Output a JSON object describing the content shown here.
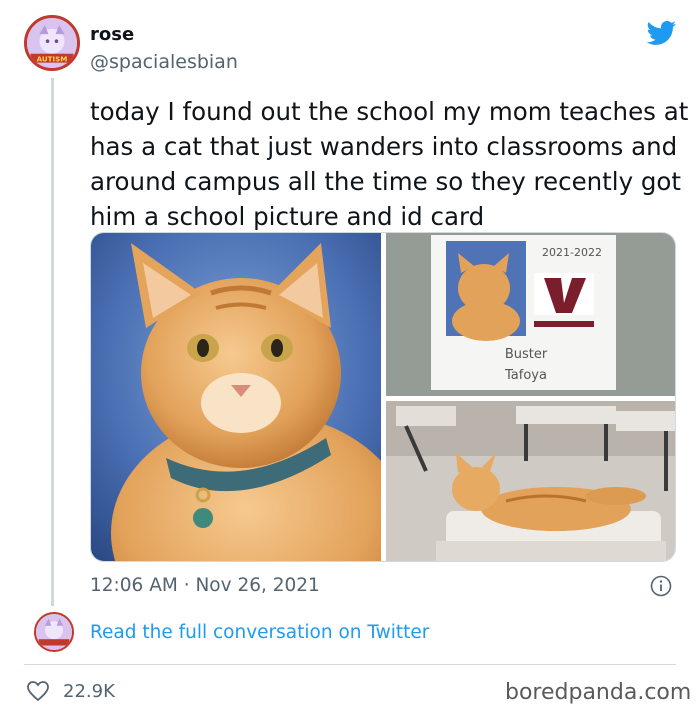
{
  "tweet": {
    "author_name": "rose",
    "author_handle": "@spacialesbian",
    "avatar_badge": "AUTISM",
    "text": "today I found out the school my mom teaches at has a cat that just wanders into classrooms and around campus all the time so they recently got him a school picture and id card",
    "timestamp": "12:06 AM · Nov 26, 2021",
    "read_more_label": "Read the full conversation on Twitter",
    "like_count": "22.9K"
  },
  "id_card": {
    "year": "2021-2022",
    "first_name": "Buster",
    "last_name": "Tafoya"
  },
  "watermark": "boredpanda.com",
  "colors": {
    "twitter_blue": "#1d9bf0",
    "text_primary": "#0f1419",
    "text_secondary": "#536471",
    "avatar_border": "#c0392b"
  },
  "icons": {
    "logo": "twitter-bird-icon",
    "info": "info-icon",
    "like": "heart-icon"
  }
}
